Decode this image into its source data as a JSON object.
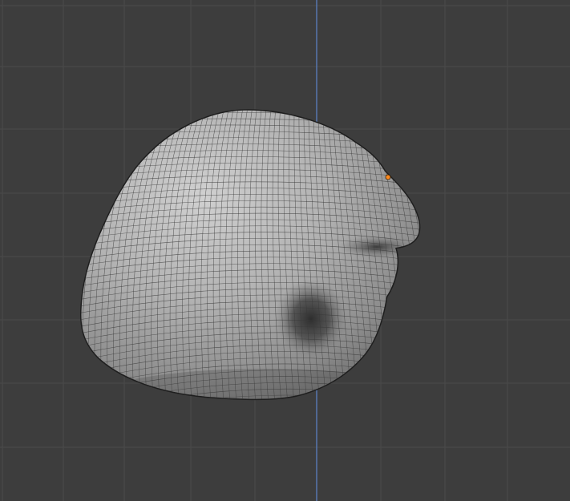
{
  "viewport": {
    "name": "3D Viewport",
    "background_color": "#3d3d3d",
    "grid_color": "#4a4a4a",
    "z_axis_color": "#5a7fbf"
  },
  "object": {
    "type": "subdivided sculpt mesh",
    "surface_color": "#a8a8a8",
    "wire_color": "#3a3a3a",
    "selected_vertex_color": "#ff8a1f"
  }
}
